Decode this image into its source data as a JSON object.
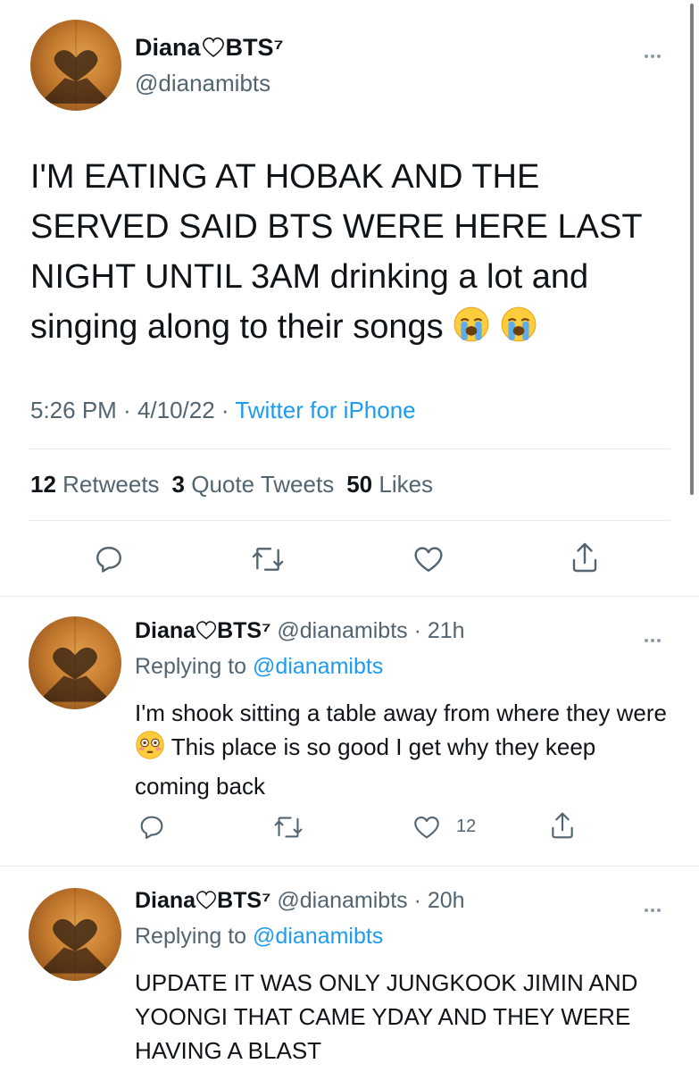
{
  "main_tweet": {
    "display_name": "Diana",
    "name_suffix": "BTS⁷",
    "handle": "@dianamibts",
    "text_caps": "I'M EATING AT HOBAK AND THE SERVED SAID BTS WERE HERE LAST NIGHT UNTIL 3AM",
    "text_rest": "drinking a lot and singing along to their songs",
    "time": "5:26 PM",
    "date": "4/10/22",
    "source": "Twitter for iPhone",
    "retweets_count": "12",
    "retweets_label": "Retweets",
    "quotes_count": "3",
    "quotes_label": "Quote Tweets",
    "likes_count": "50",
    "likes_label": "Likes"
  },
  "replies": [
    {
      "display_name": "Diana",
      "name_suffix": "BTS⁷",
      "handle": "@dianamibts",
      "age": "21h",
      "replying_label": "Replying to",
      "replying_to": "@dianamibts",
      "text_a": "I'm shook sitting a table away from where they were",
      "text_b": "This place is so good I get why they keep coming back",
      "like_count": "12"
    },
    {
      "display_name": "Diana",
      "name_suffix": "BTS⁷",
      "handle": "@dianamibts",
      "age": "20h",
      "replying_label": "Replying to",
      "replying_to": "@dianamibts",
      "text": "UPDATE IT WAS ONLY JUNGKOOK JIMIN AND YOONGI THAT CAME YDAY AND THEY WERE HAVING A BLAST"
    }
  ],
  "colors": {
    "link": "#1d9bf0",
    "secondary": "#536471",
    "text": "#0f1419"
  },
  "icons": [
    "reply-icon",
    "retweet-icon",
    "like-icon",
    "share-icon",
    "more-icon",
    "heart-outline-icon",
    "loudly-crying-face-emoji",
    "flushed-face-emoji"
  ]
}
